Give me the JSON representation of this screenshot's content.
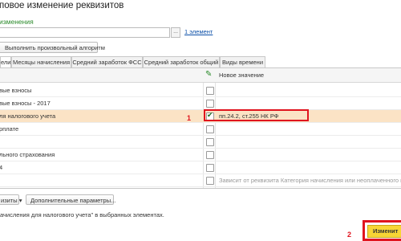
{
  "window": {
    "title": "повое изменение реквизитов",
    "subtitle": "изменения"
  },
  "object_selector": {
    "value": "",
    "dots_label": "...",
    "count_link": "1 элемент"
  },
  "toolbar": {
    "algorithm_button": "Выполнить произвольный алгоритм"
  },
  "tabs": [
    {
      "label": "ели"
    },
    {
      "label": "Месяцы начисления"
    },
    {
      "label": "Средний заработок ФСС"
    },
    {
      "label": "Средний заработок общий"
    },
    {
      "label": "Виды времени"
    }
  ],
  "grid": {
    "value_column_header": "Новое значение",
    "edit_icon": "pencil-icon",
    "rows": [
      {
        "name": "вые взносы",
        "checked": false,
        "value": ""
      },
      {
        "name": "вые взносы - 2017",
        "checked": false,
        "value": ""
      },
      {
        "name": "ля налогового учета",
        "checked": true,
        "value": "пп.24.2, ст.255 НК РФ"
      },
      {
        "name": "рплате",
        "checked": false,
        "value": ""
      },
      {
        "name": "",
        "checked": false,
        "value": ""
      },
      {
        "name": "льного страхования",
        "checked": false,
        "value": ""
      },
      {
        "name": "4",
        "checked": false,
        "value": ""
      },
      {
        "name": "",
        "checked": false,
        "value": "Зависит от реквизита Категория начисления или неоплаченного време"
      },
      {
        "name": "",
        "checked": false,
        "value": ""
      }
    ]
  },
  "annotations": {
    "marker_1": "1",
    "marker_2": "2",
    "color": "#e0141e"
  },
  "bottom": {
    "attrs_button": "изиты",
    "attrs_arrow": "▾",
    "extra_params_button": "Дополнительные параметры..."
  },
  "status_text": "ачисления для налогового учета\" в выбранных элементах.",
  "apply_button": "Изменит"
}
